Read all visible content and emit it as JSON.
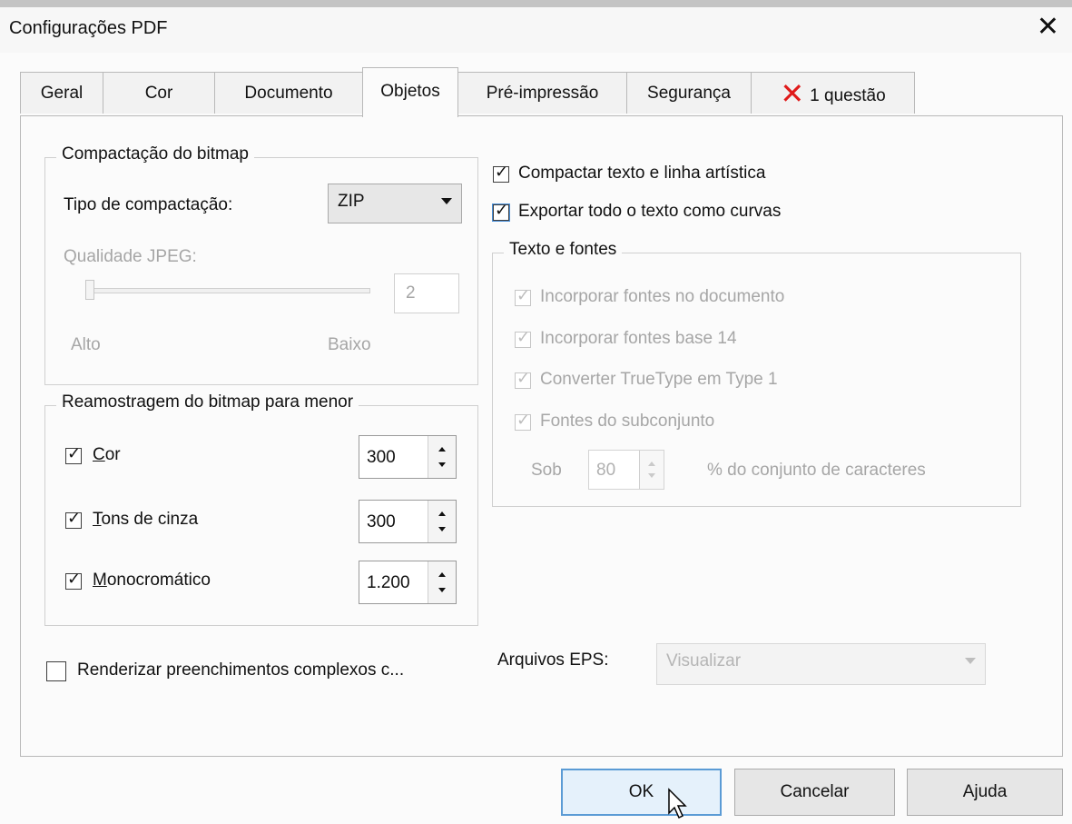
{
  "window": {
    "title": "Configurações PDF",
    "close_glyph": "✕"
  },
  "tabs": [
    {
      "label": "Geral"
    },
    {
      "label": "Cor"
    },
    {
      "label": "Documento"
    },
    {
      "label": "Objetos",
      "active": true
    },
    {
      "label": "Pré-impressão"
    },
    {
      "label": "Segurança"
    },
    {
      "label": "1 questão",
      "icon": "error-x-icon"
    }
  ],
  "bitmap_compression": {
    "title": "Compactação do bitmap",
    "type_label": "Tipo de compactação:",
    "type_value": "ZIP",
    "jpeg_quality_label": "Qualidade JPEG:",
    "jpeg_quality_value": "2",
    "slider_low_label": "Alto",
    "slider_high_label": "Baixo"
  },
  "downsample": {
    "title": "Reamostragem do bitmap para menor",
    "rows": [
      {
        "label": "Cor",
        "mnemonic": "C",
        "checked": true,
        "value": "300"
      },
      {
        "label": "Tons de cinza",
        "mnemonic": "T",
        "checked": true,
        "value": "300"
      },
      {
        "label": "Monocromático",
        "mnemonic": "M",
        "checked": true,
        "value": "1.200"
      }
    ]
  },
  "options": {
    "compress_text": {
      "label": "Compactar texto e linha artística",
      "checked": true
    },
    "export_text_curves": {
      "label": "Exportar todo o texto como curvas",
      "checked": true
    }
  },
  "text_fonts": {
    "title": "Texto e fontes",
    "embed_fonts": {
      "label": "Incorporar fontes no documento",
      "checked": true
    },
    "embed_base14": {
      "label": "Incorporar fontes base 14",
      "checked": true
    },
    "convert_truetype": {
      "label": "Converter TrueType em Type 1",
      "checked": true
    },
    "subset_fonts": {
      "label": "Fontes do subconjunto",
      "checked": true
    },
    "subset_prefix": "Sob",
    "subset_value": "80",
    "subset_suffix": "% do conjunto de caracteres"
  },
  "render_complex": {
    "label": "Renderizar preenchimentos complexos c...",
    "checked": false
  },
  "eps": {
    "label": "Arquivos EPS:",
    "value": "Visualizar"
  },
  "buttons": {
    "ok": "OK",
    "cancel": "Cancelar",
    "help": "Ajuda"
  },
  "colors": {
    "accent": "#5b9bd5",
    "error": "#e01b1b",
    "disabled_text": "#a6a6a6"
  }
}
